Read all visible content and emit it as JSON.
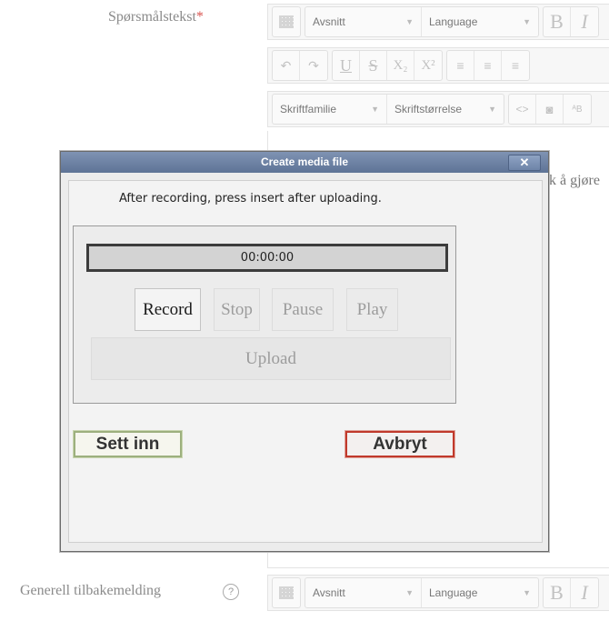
{
  "form": {
    "question_text_label": "Spørsmålstekst",
    "required_mark": "*",
    "general_feedback_label": "Generell tilbakemelding",
    "help_icon_glyph": "?",
    "partial_hint_text": "k å gjøre"
  },
  "toolbar": {
    "paragraph": "Avsnitt",
    "language": "Language",
    "bold": "B",
    "italic": "I",
    "underline": "U",
    "strike": "S",
    "subscript": "X₂",
    "superscript": "X²",
    "font_family": "Skriftfamilie",
    "font_size": "Skriftstørrelse",
    "html_glyph": "<>"
  },
  "dialog": {
    "title": "Create media file",
    "close_glyph": "✕",
    "instruction": "After recording, press insert after uploading.",
    "timer": "00:00:00",
    "record": "Record",
    "stop": "Stop",
    "pause": "Pause",
    "play": "Play",
    "upload": "Upload",
    "insert": "Sett inn",
    "cancel": "Avbryt"
  },
  "icons": [
    "table-icon",
    "undo-icon",
    "redo-icon",
    "align-left-icon",
    "align-center-icon",
    "align-right-icon",
    "binoculars-icon",
    "spellcheck-icon",
    "help-icon"
  ]
}
